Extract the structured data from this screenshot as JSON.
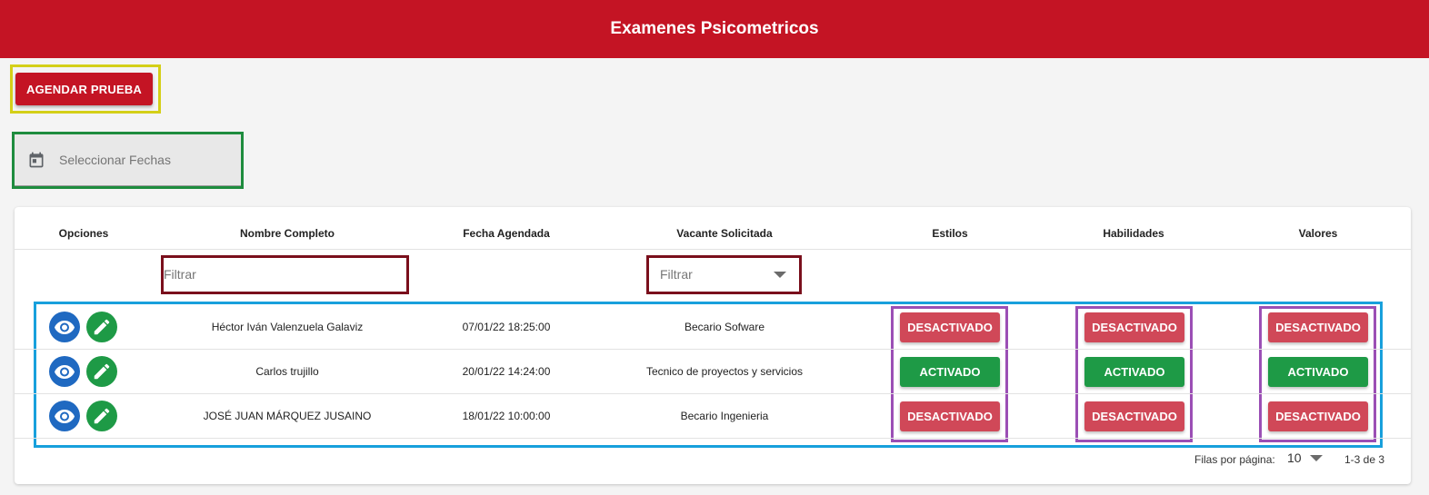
{
  "header": {
    "title": "Examenes Psicometricos"
  },
  "actions": {
    "schedule_button": "AGENDAR PRUEBA"
  },
  "date_picker": {
    "placeholder": "Seleccionar Fechas",
    "icon": "calendar-icon"
  },
  "table": {
    "columns": [
      "Opciones",
      "Nombre Completo",
      "Fecha Agendada",
      "Vacante Solicitada",
      "Estilos",
      "Habilidades",
      "Valores"
    ],
    "filters": {
      "name_placeholder": "Filtrar",
      "vacancy_placeholder": "Filtrar"
    },
    "rows": [
      {
        "name": "Héctor Iván Valenzuela Galaviz",
        "date": "07/01/22 18:25:00",
        "vacancy": "Becario Sofware",
        "estilos": "DESACTIVADO",
        "habilidades": "DESACTIVADO",
        "valores": "DESACTIVADO"
      },
      {
        "name": "Carlos trujillo",
        "date": "20/01/22 14:24:00",
        "vacancy": "Tecnico de proyectos y servicios",
        "estilos": "ACTIVADO",
        "habilidades": "ACTIVADO",
        "valores": "ACTIVADO"
      },
      {
        "name": "JOSÉ JUAN MÁRQUEZ JUSAINO",
        "date": "18/01/22 10:00:00",
        "vacancy": "Becario Ingenieria",
        "estilos": "DESACTIVADO",
        "habilidades": "DESACTIVADO",
        "valores": "DESACTIVADO"
      }
    ],
    "pagination": {
      "rows_label": "Filas por página:",
      "rows_per_page": "10",
      "range": "1-3 de 3"
    }
  },
  "colors": {
    "brand_red": "#c41424",
    "active_green": "#1e9a46",
    "inactive_red": "#d04858",
    "view_blue": "#1f69c1"
  }
}
